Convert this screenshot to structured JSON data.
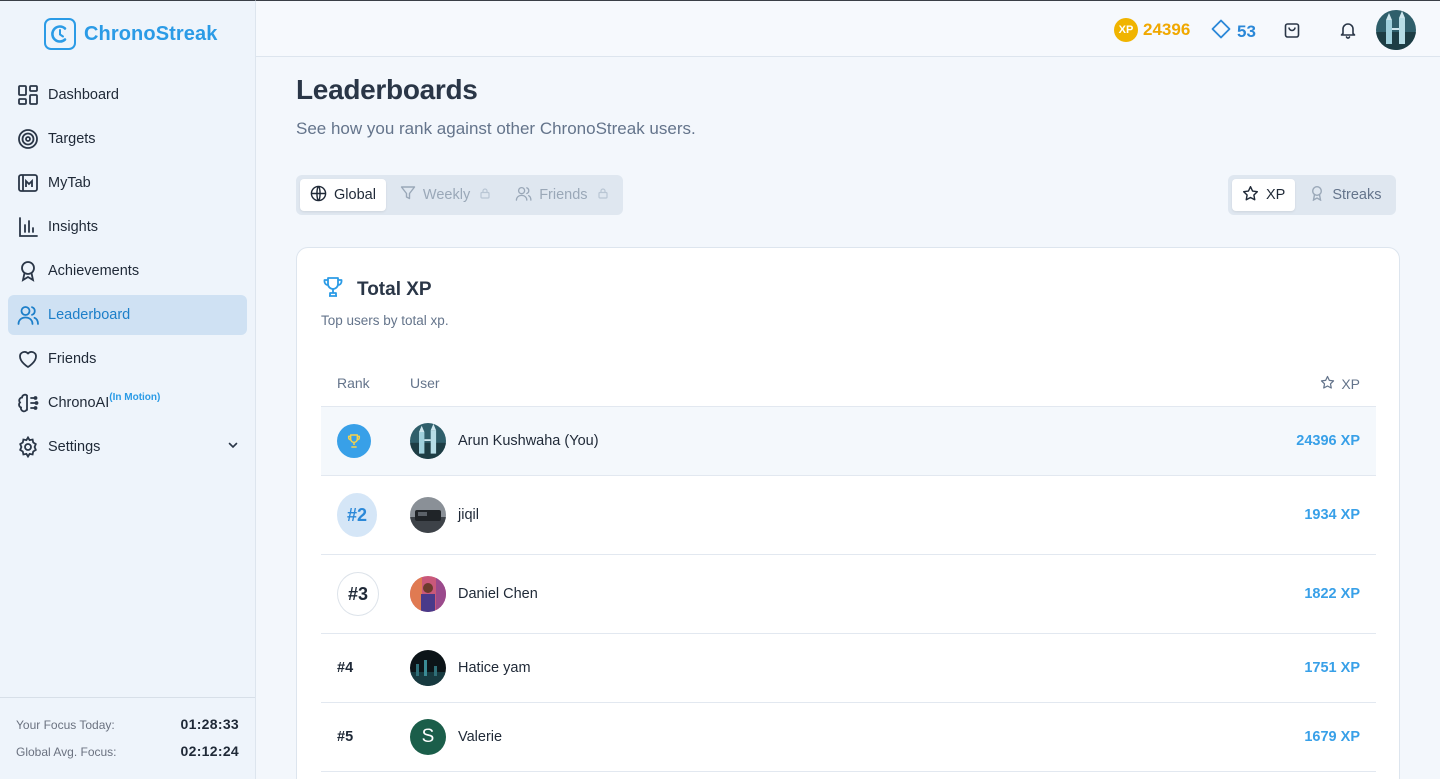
{
  "app": {
    "name": "ChronoStreak"
  },
  "sidebar": {
    "items": [
      {
        "label": "Dashboard",
        "icon": "dashboard-icon"
      },
      {
        "label": "Targets",
        "icon": "target-icon"
      },
      {
        "label": "MyTab",
        "icon": "mytab-icon"
      },
      {
        "label": "Insights",
        "icon": "bar-chart-icon"
      },
      {
        "label": "Achievements",
        "icon": "award-icon"
      },
      {
        "label": "Leaderboard",
        "icon": "users-icon",
        "active": true
      },
      {
        "label": "Friends",
        "icon": "heart-icon"
      },
      {
        "label": "ChronoAI",
        "icon": "brain-icon",
        "sup": "(In Motion)"
      },
      {
        "label": "Settings",
        "icon": "gear-icon"
      }
    ],
    "focus": {
      "today_label": "Your Focus Today:",
      "today_value": "01:28:33",
      "global_label": "Global Avg. Focus:",
      "global_value": "02:12:24"
    }
  },
  "header": {
    "xp_coin": "XP",
    "xp_value": "24396",
    "gems_value": "53"
  },
  "page": {
    "title": "Leaderboards",
    "subtitle": "See how you rank against other ChronoStreak users."
  },
  "scope_tabs": [
    {
      "label": "Global",
      "active": true
    },
    {
      "label": "Weekly",
      "locked": true
    },
    {
      "label": "Friends",
      "locked": true
    }
  ],
  "metric_tabs": [
    {
      "label": "XP",
      "active": true
    },
    {
      "label": "Streaks"
    }
  ],
  "card": {
    "title": "Total XP",
    "subtitle": "Top users by total xp.",
    "columns": {
      "rank": "Rank",
      "user": "User",
      "xp": "XP"
    },
    "rows": [
      {
        "rank": "",
        "name": "Arun Kushwaha (You)",
        "xp": "24396 XP"
      },
      {
        "rank": "#2",
        "name": "jiqil",
        "xp": "1934 XP"
      },
      {
        "rank": "#3",
        "name": "Daniel Chen",
        "xp": "1822 XP"
      },
      {
        "rank": "#4",
        "name": "Hatice yam",
        "xp": "1751 XP"
      },
      {
        "rank": "#5",
        "name": "Valerie",
        "xp": "1679 XP",
        "initial": "S"
      }
    ]
  },
  "colors": {
    "accent": "#2b9be6",
    "xp_gold": "#f0b400",
    "active_nav_bg": "#cfe1f3"
  }
}
